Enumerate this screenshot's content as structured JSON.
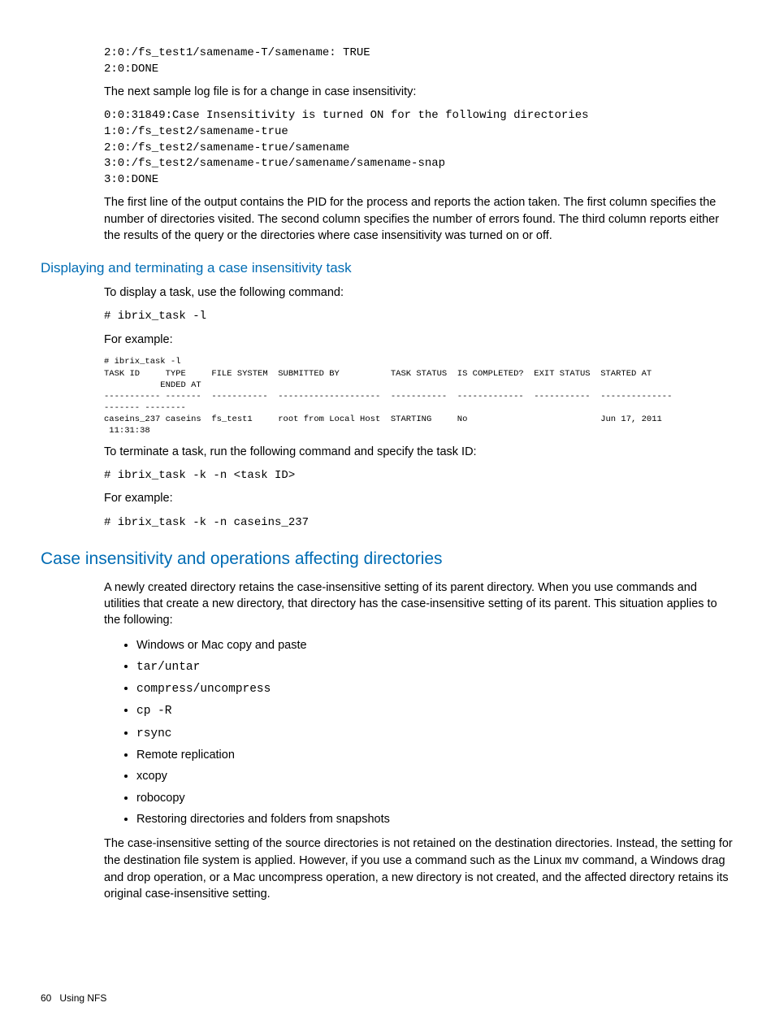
{
  "block1_code": "2:0:/fs_test1/samename-T/samename: TRUE\n2:0:DONE",
  "para1": "The next sample log file is for a change in case insensitivity:",
  "block2_code": "0:0:31849:Case Insensitivity is turned ON for the following directories\n1:0:/fs_test2/samename-true\n2:0:/fs_test2/samename-true/samename\n3:0:/fs_test2/samename-true/samename/samename-snap\n3:0:DONE",
  "para2": "The first line of the output contains the PID for the process and reports the action taken. The first column specifies the number of directories visited. The second column specifies the number of errors found. The third column reports either the results of the query or the directories where case insensitivity was turned on or off.",
  "sec1_title": "Displaying and terminating a case insensitivity task",
  "sec1_para1": "To display a task, use the following command:",
  "sec1_cmd1": "# ibrix_task -l",
  "sec1_example_label": "For example:",
  "sec1_pre": "# ibrix_task -l\nTASK ID     TYPE     FILE SYSTEM  SUBMITTED BY          TASK STATUS  IS COMPLETED?  EXIT STATUS  STARTED AT  \n           ENDED AT\n----------- -------  -----------  --------------------  -----------  -------------  -----------  --------------\n------- --------\ncaseins_237 caseins  fs_test1     root from Local Host  STARTING     No                          Jun 17, 2011\n 11:31:38",
  "sec1_para2": "To terminate a task, run the following command and specify the task ID:",
  "sec1_cmd2": "# ibrix_task -k -n <task ID>",
  "sec1_example_label2": "For example:",
  "sec1_cmd3": "# ibrix_task -k -n caseins_237",
  "sec2_title": "Case insensitivity and operations affecting directories",
  "sec2_para1": "A newly created directory retains the case-insensitive setting of its parent directory. When you use commands and utilities that create a new directory, that directory has the case-insensitive setting of its parent. This situation applies to the following:",
  "bullets": [
    "Windows or Mac copy and paste",
    "tar/untar",
    "compress/uncompress",
    "cp -R",
    "rsync",
    "Remote replication",
    "xcopy",
    "robocopy",
    "Restoring directories and folders from snapshots"
  ],
  "sec2_para2_pre": "The case-insensitive setting of the source directories is not retained on the destination directories. Instead, the setting for the destination file system is applied. However, if you use a command such as the Linux ",
  "sec2_para2_mv": "mv",
  "sec2_para2_post": " command, a Windows drag and drop operation, or a Mac uncompress operation, a new directory is not created, and the affected directory retains its original case-insensitive setting.",
  "footer_page": "60",
  "footer_text": "Using NFS"
}
